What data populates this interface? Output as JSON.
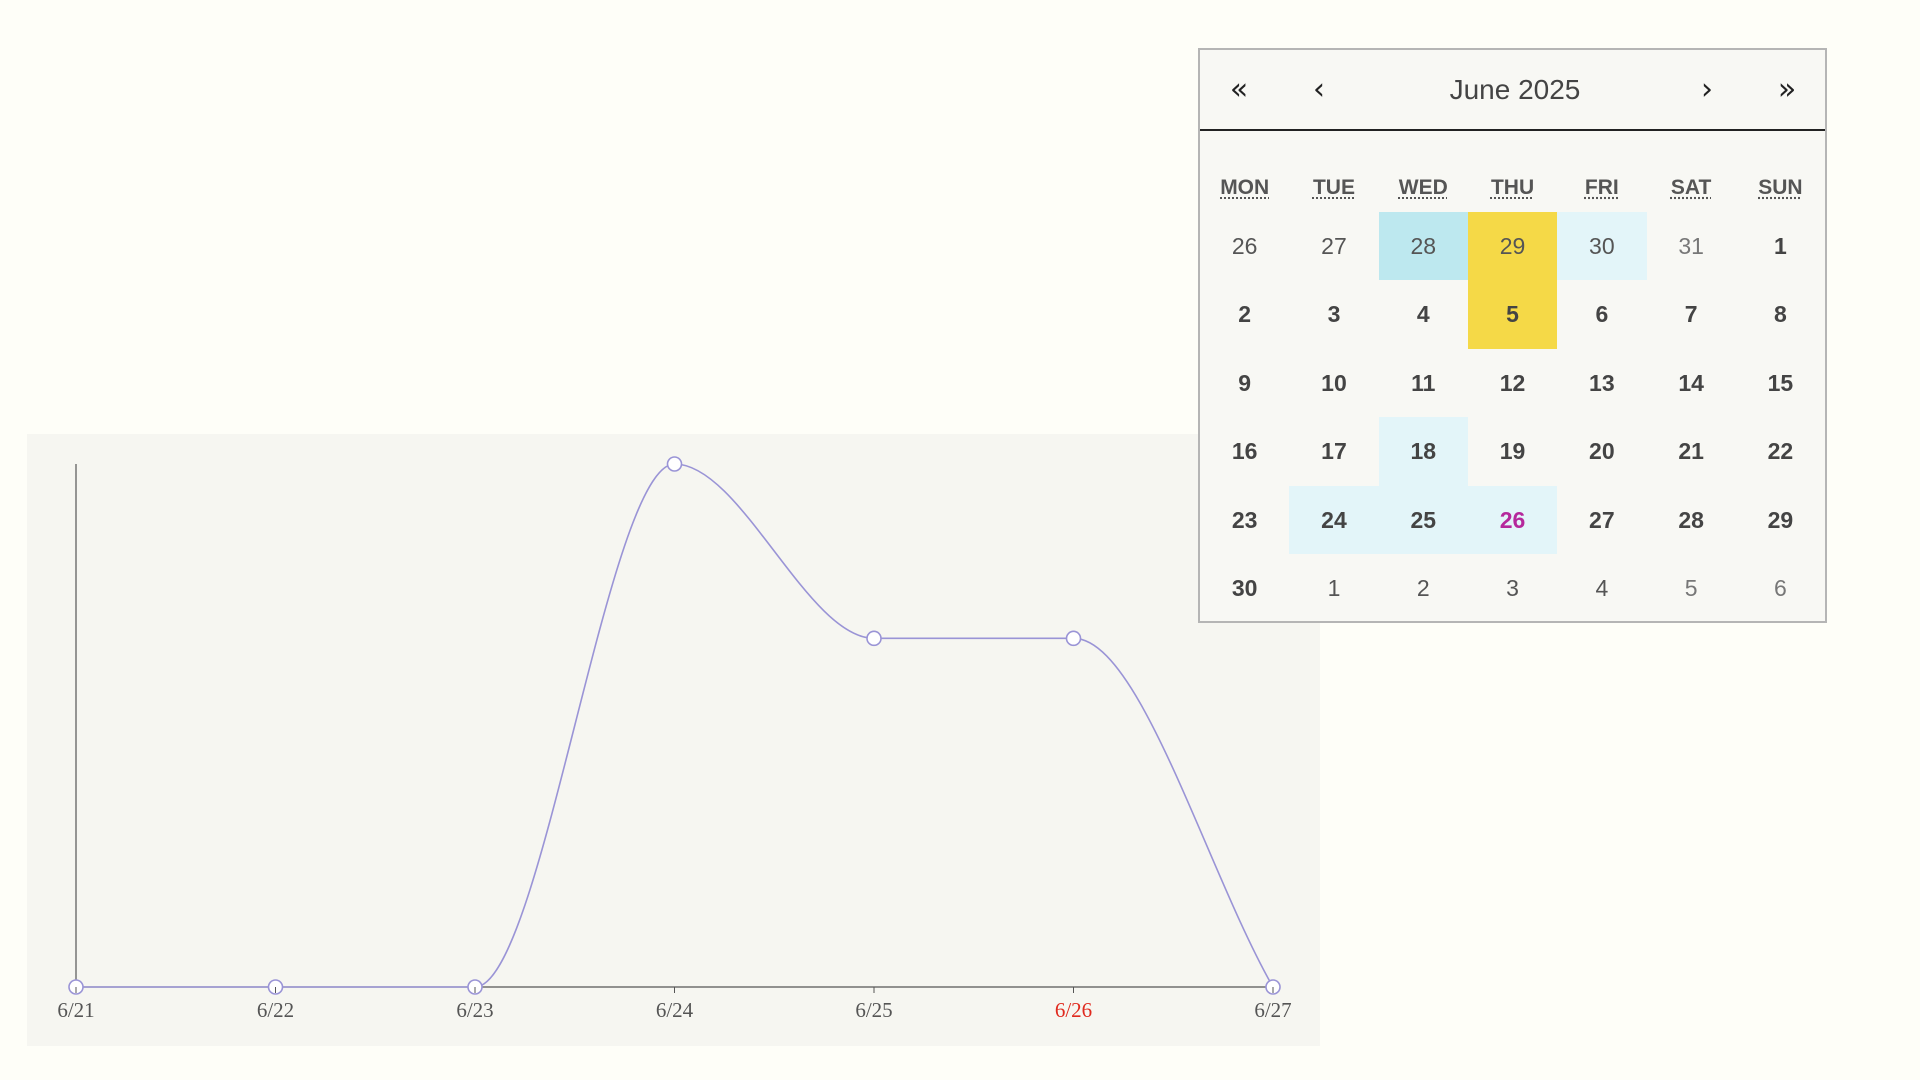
{
  "chart": {
    "chart_data": {
      "type": "line",
      "categories": [
        "6/21",
        "6/22",
        "6/23",
        "6/24",
        "6/25",
        "6/26",
        "6/27"
      ],
      "series": [
        {
          "values": [
            0,
            0,
            0,
            3,
            2,
            2,
            0
          ]
        }
      ],
      "ylim": [
        0,
        3
      ],
      "line_color": "#9a94d6",
      "marker_fill": "#ffffff",
      "highlight_tick": "6/26",
      "highlight_tick_color": "#e02a1f",
      "tick_color": "#555555",
      "axis_color": "#555555"
    }
  },
  "calendar": {
    "title": "June 2025",
    "nav": {
      "prev_year": "«",
      "prev_month": "‹",
      "next_month": "›",
      "next_year": "»"
    },
    "weekdays": [
      "MON",
      "TUE",
      "WED",
      "THU",
      "FRI",
      "SAT",
      "SUN"
    ],
    "colors": {
      "highlight_dark": "#bde8ef",
      "highlight_light": "#e3f5f9",
      "highlight_yellow": "#f5d947",
      "today": "#b5289c"
    },
    "weeks": [
      [
        {
          "label": "26",
          "month": "prev"
        },
        {
          "label": "27",
          "month": "prev"
        },
        {
          "label": "28",
          "month": "prev",
          "highlight": "dark"
        },
        {
          "label": "29",
          "month": "prev",
          "highlight": "yellow"
        },
        {
          "label": "30",
          "month": "prev",
          "highlight": "light"
        },
        {
          "label": "31",
          "month": "prev"
        },
        {
          "label": "1",
          "month": "current"
        }
      ],
      [
        {
          "label": "2",
          "month": "current"
        },
        {
          "label": "3",
          "month": "current"
        },
        {
          "label": "4",
          "month": "current"
        },
        {
          "label": "5",
          "month": "current",
          "highlight": "yellow"
        },
        {
          "label": "6",
          "month": "current"
        },
        {
          "label": "7",
          "month": "current"
        },
        {
          "label": "8",
          "month": "current"
        }
      ],
      [
        {
          "label": "9",
          "month": "current"
        },
        {
          "label": "10",
          "month": "current"
        },
        {
          "label": "11",
          "month": "current"
        },
        {
          "label": "12",
          "month": "current"
        },
        {
          "label": "13",
          "month": "current"
        },
        {
          "label": "14",
          "month": "current"
        },
        {
          "label": "15",
          "month": "current"
        }
      ],
      [
        {
          "label": "16",
          "month": "current"
        },
        {
          "label": "17",
          "month": "current"
        },
        {
          "label": "18",
          "month": "current",
          "highlight": "light"
        },
        {
          "label": "19",
          "month": "current"
        },
        {
          "label": "20",
          "month": "current"
        },
        {
          "label": "21",
          "month": "current"
        },
        {
          "label": "22",
          "month": "current"
        }
      ],
      [
        {
          "label": "23",
          "month": "current"
        },
        {
          "label": "24",
          "month": "current",
          "highlight": "light"
        },
        {
          "label": "25",
          "month": "current",
          "highlight": "light"
        },
        {
          "label": "26",
          "month": "current",
          "highlight": "light",
          "today": true
        },
        {
          "label": "27",
          "month": "current"
        },
        {
          "label": "28",
          "month": "current"
        },
        {
          "label": "29",
          "month": "current"
        }
      ],
      [
        {
          "label": "30",
          "month": "current"
        },
        {
          "label": "1",
          "month": "next"
        },
        {
          "label": "2",
          "month": "next"
        },
        {
          "label": "3",
          "month": "next"
        },
        {
          "label": "4",
          "month": "next"
        },
        {
          "label": "5",
          "month": "next"
        },
        {
          "label": "6",
          "month": "next"
        }
      ]
    ]
  }
}
